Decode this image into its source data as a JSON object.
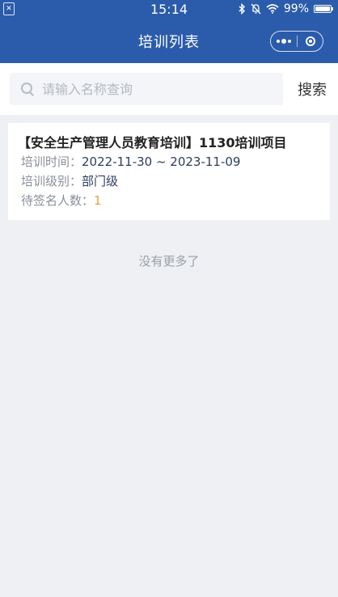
{
  "status_bar": {
    "time": "15:14",
    "battery": "99%",
    "battery_level": 0.99
  },
  "nav": {
    "title": "培训列表"
  },
  "search": {
    "placeholder": "请输入名称查询",
    "value": "",
    "button_label": "搜索"
  },
  "list": {
    "items": [
      {
        "title": "【安全生产管理人员教育培训】1130培训项目",
        "time_label": "培训时间：",
        "time_value": "2022-11-30 ~ 2023-11-09",
        "level_label": "培训级别：",
        "level_value": "部门级",
        "pending_label": "待签名人数：",
        "pending_value": "1"
      }
    ],
    "footer_text": "没有更多了"
  },
  "colors": {
    "header_bg": "#2b5cab",
    "accent_orange": "#e8a33a"
  }
}
